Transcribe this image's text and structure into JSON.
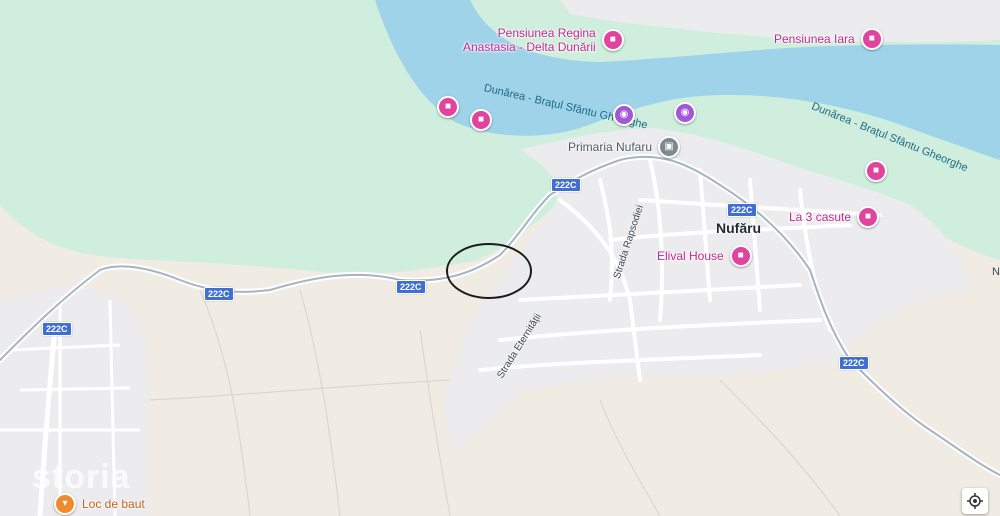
{
  "map": {
    "colors": {
      "land": "#f1ece3",
      "forest": "#cfeedd",
      "water": "#9fd3ea",
      "town": "#ececee",
      "road": "#ffffff",
      "main_road": "#a6b4c3",
      "annotation": "#1b1b1b",
      "poi_pink": "#e0449e",
      "poi_purple": "#a356d6"
    },
    "pois": [
      {
        "label": "Pensiunea Regina\nAnastasia - Delta Dunării",
        "icon": "bed-icon",
        "color": "pink"
      },
      {
        "label": "Pensiunea Iara",
        "icon": "bed-icon",
        "color": "pink"
      },
      {
        "label": "Primaria Nufaru",
        "icon": "city-hall-icon",
        "color": "grey"
      },
      {
        "label": "La 3 casute",
        "icon": "bed-icon",
        "color": "pink"
      },
      {
        "label": "Elival House",
        "icon": "bed-icon",
        "color": "pink"
      },
      {
        "label": "Loc de baut",
        "icon": "cocktail-icon",
        "color": "orange"
      }
    ],
    "unlabeled_markers": [
      {
        "icon": "bed-icon",
        "color": "pink"
      },
      {
        "icon": "bed-icon",
        "color": "pink"
      },
      {
        "icon": "bed-icon",
        "color": "pink"
      },
      {
        "icon": "camera-icon",
        "color": "purple"
      },
      {
        "icon": "camera-icon",
        "color": "purple"
      }
    ],
    "place_name": "Nufăru",
    "river_labels": [
      "Dunărea - Brațul Sfântu Gheorghe",
      "Dunărea - Brațul Sfântu Gheorghe"
    ],
    "streets": [
      "Strada Rapsodiei",
      "Strada Eternității"
    ],
    "road_shields": [
      "222C",
      "222C",
      "222C",
      "222C",
      "222C",
      "222C"
    ],
    "edge_text": "N",
    "watermark": "storia",
    "controls": {
      "locate_icon": "my-location-icon"
    }
  }
}
